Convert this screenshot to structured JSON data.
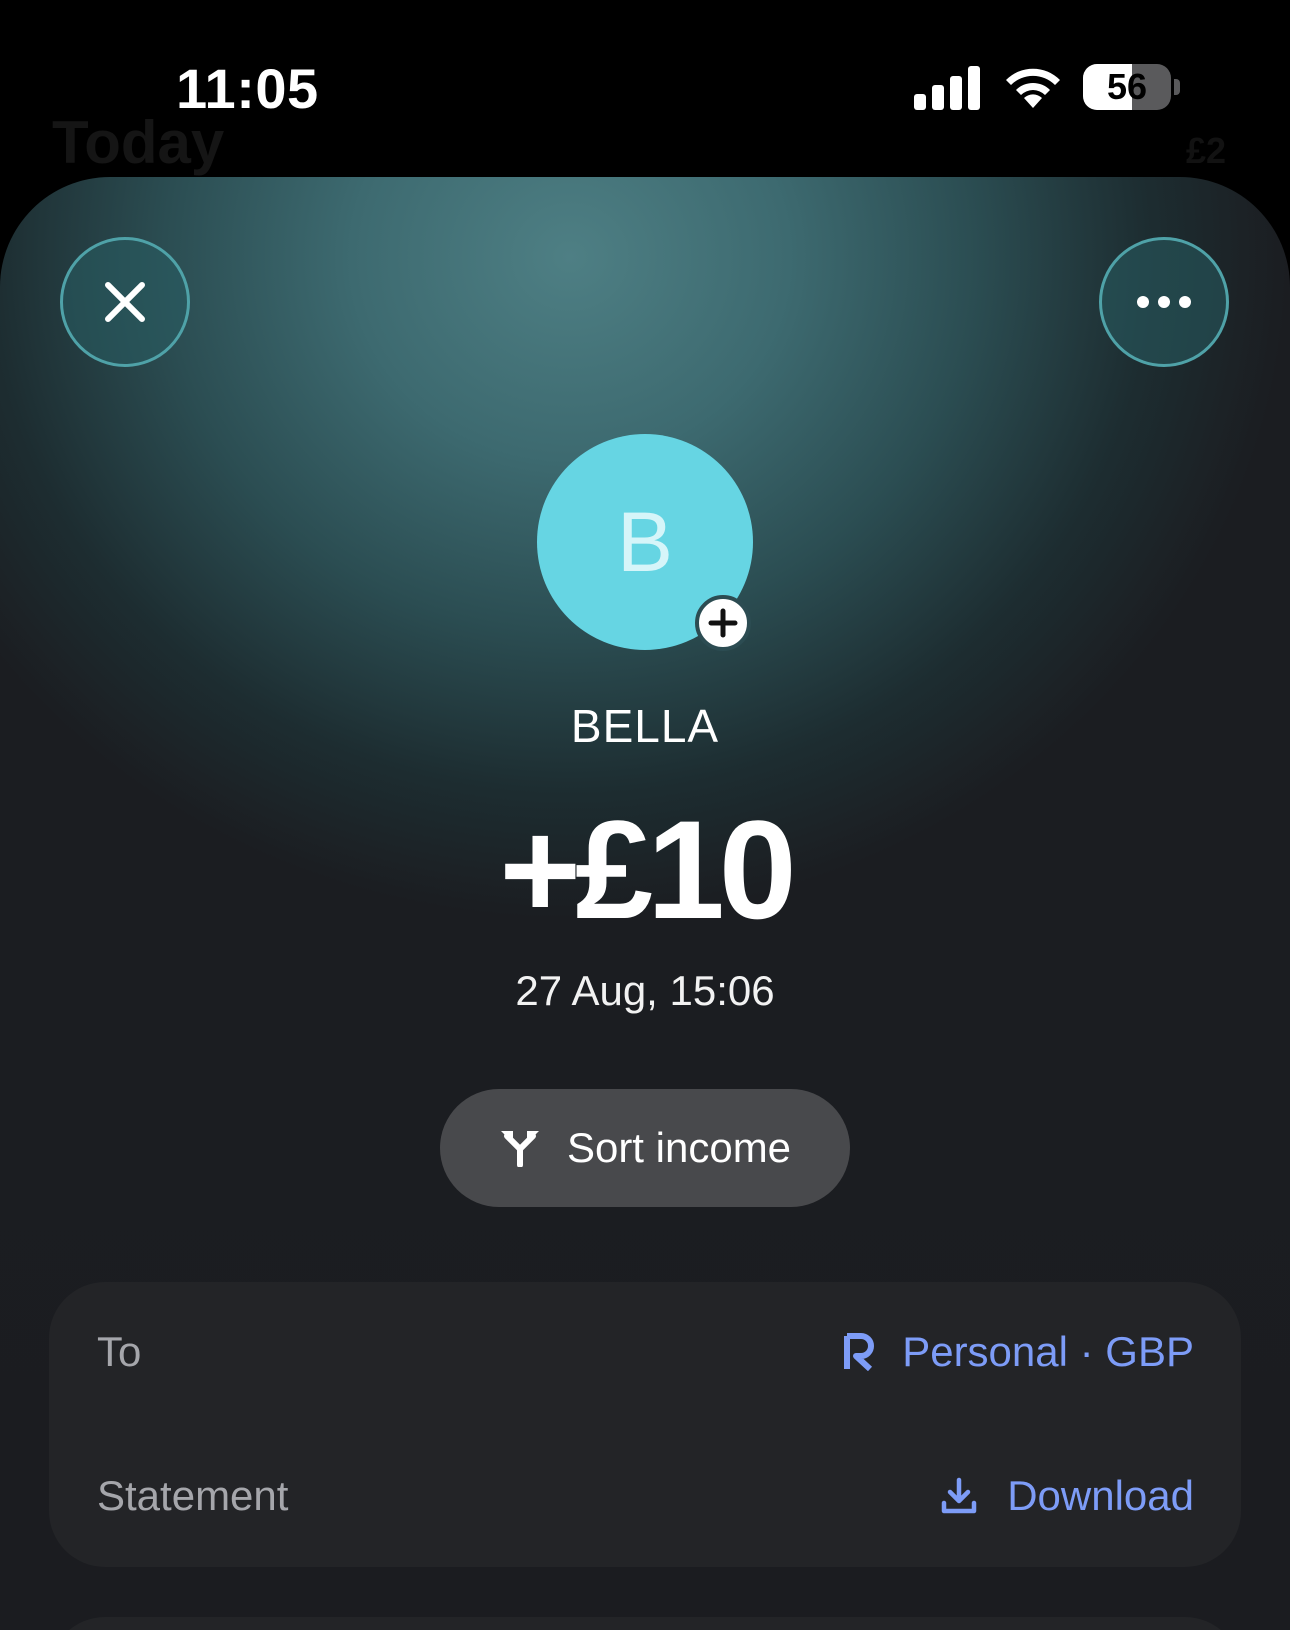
{
  "status_bar": {
    "time": "11:05",
    "battery_percent": 56,
    "battery_label": "56",
    "icons": [
      "signal-icon",
      "wifi-icon",
      "battery-icon"
    ]
  },
  "background": {
    "title": "Today",
    "right_text": "£2"
  },
  "header": {
    "close_icon": "close-icon",
    "more_icon": "more-horizontal-icon"
  },
  "transaction": {
    "avatar_letter": "B",
    "avatar_color": "#66d5e3",
    "avatar_add_icon": "plus-icon",
    "name": "BELLA",
    "amount": "+£10",
    "datetime": "27 Aug, 15:06"
  },
  "actions": {
    "sort_icon": "split-arrows-icon",
    "sort_label": "Sort income"
  },
  "details": {
    "to_label": "To",
    "to_value": "Personal · GBP",
    "to_icon": "revolut-logo-icon",
    "statement_label": "Statement",
    "statement_value": "Download",
    "statement_icon": "download-icon"
  },
  "colors": {
    "accent": "#7d9cf7",
    "sheet_top": "#4e7f84",
    "sheet_bottom": "#1b1d21",
    "card": "#232427"
  }
}
